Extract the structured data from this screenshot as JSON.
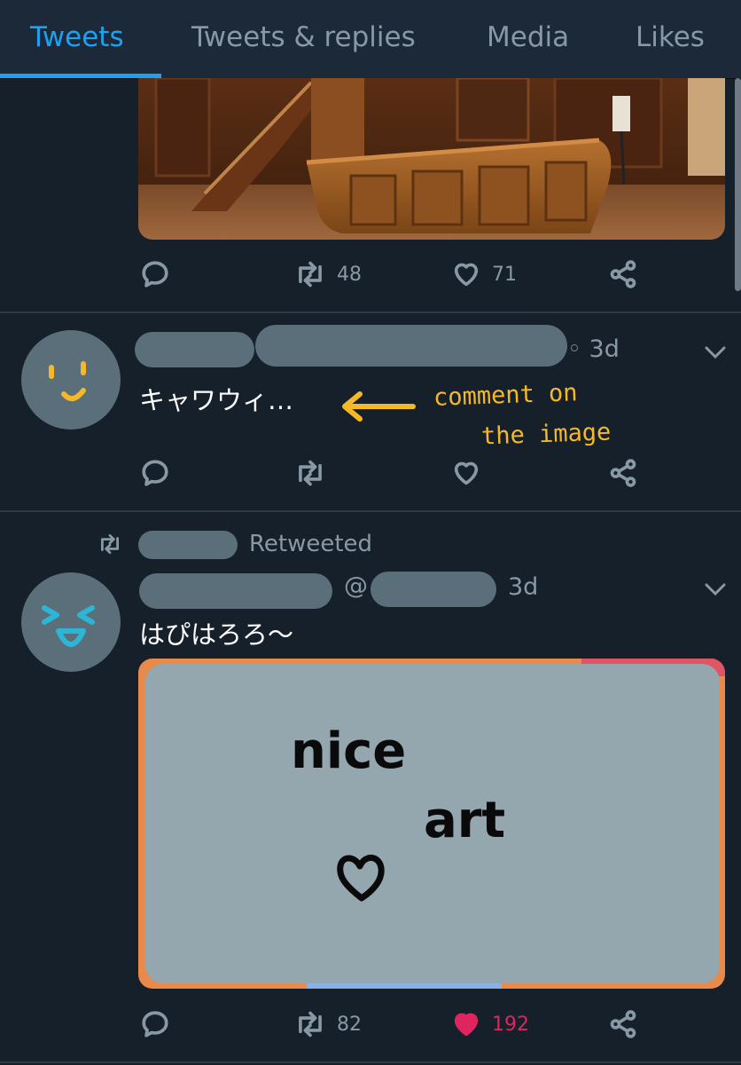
{
  "tabs": [
    {
      "label": "Tweets",
      "active": true
    },
    {
      "label": "Tweets & replies",
      "active": false
    },
    {
      "label": "Media",
      "active": false
    },
    {
      "label": "Likes",
      "active": false
    }
  ],
  "tweet1": {
    "image_icon": "wooden-courtroom-photo",
    "actions": {
      "retweets": "48",
      "likes": "71"
    }
  },
  "tweet2": {
    "time": "3d",
    "text": "キャワウィ…",
    "annotation_line1": "comment on",
    "annotation_line2": "the image",
    "avatar_icon": "smiley-face-drawing"
  },
  "tweet3": {
    "retweeted_label": "Retweeted",
    "handle_at": "@",
    "time": "3d",
    "text": "はぴはろろ〜",
    "avatar_icon": "laughing-face-drawing",
    "media_overlay_line1": "nice",
    "media_overlay_line2": "art",
    "actions": {
      "retweets": "82",
      "likes": "192",
      "liked": true
    }
  },
  "colors": {
    "background": "#15202b",
    "accent": "#1da1f2",
    "muted": "#8899a6",
    "like": "#e0245e",
    "annotation": "#f5b928",
    "redaction": "#5b6f7b"
  }
}
